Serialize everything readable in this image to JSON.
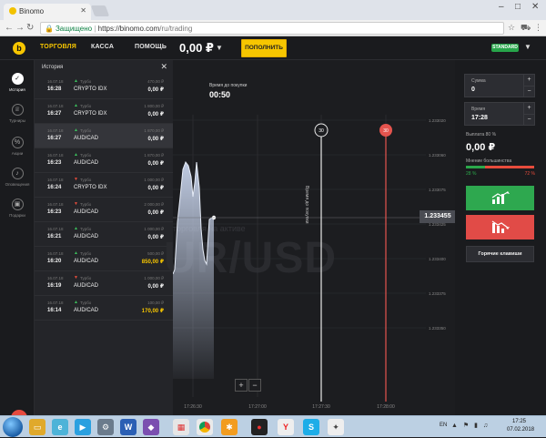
{
  "browser": {
    "tab_title": "Binomo",
    "url_secure": "Защищено",
    "url_domain": "https://binomo.com",
    "url_path": "/ru/trading"
  },
  "topbar": {
    "nav": [
      "ТОРГОВЛЯ",
      "КАССА",
      "ПОМОЩЬ"
    ],
    "balance": "0,00 ₽",
    "deposit_label": "ПОПОЛНИТЬ",
    "status_badge": "STANDARD"
  },
  "rail": {
    "items": [
      "История",
      "Турниры",
      "Акции",
      "Оповещения",
      "Подарки"
    ]
  },
  "history": {
    "title": "История",
    "rows": [
      {
        "date": "16.07.18",
        "time": "16:28",
        "dir": "up",
        "type": "Турбо",
        "asset": "CRYPTO IDX",
        "invest": "470,00 ₽",
        "payout": "0,00 ₽"
      },
      {
        "date": "16.07.18",
        "time": "16:27",
        "dir": "up",
        "type": "Турбо",
        "asset": "CRYPTO IDX",
        "invest": "1 800,00 ₽",
        "payout": "0,00 ₽"
      },
      {
        "date": "16.07.18",
        "time": "16:27",
        "dir": "up",
        "type": "Турбо",
        "asset": "AUD/CAD",
        "invest": "1 870,00 ₽",
        "payout": "0,00 ₽"
      },
      {
        "date": "16.07.18",
        "time": "16:23",
        "dir": "up",
        "type": "Турбо",
        "asset": "AUD/CAD",
        "invest": "1 870,00 ₽",
        "payout": "0,00 ₽"
      },
      {
        "date": "16.07.18",
        "time": "16:24",
        "dir": "dn",
        "type": "Турбо",
        "asset": "CRYPTO IDX",
        "invest": "1 000,00 ₽",
        "payout": "0,00 ₽"
      },
      {
        "date": "16.07.18",
        "time": "16:23",
        "dir": "dn",
        "type": "Турбо",
        "asset": "AUD/CAD",
        "invest": "2 000,00 ₽",
        "payout": "0,00 ₽"
      },
      {
        "date": "16.07.18",
        "time": "16:21",
        "dir": "up",
        "type": "Турбо",
        "asset": "AUD/CAD",
        "invest": "1 000,00 ₽",
        "payout": "0,00 ₽"
      },
      {
        "date": "16.07.18",
        "time": "16:20",
        "dir": "up",
        "type": "Турбо",
        "asset": "AUD/CAD",
        "invest": "500,00 ₽",
        "payout": "850,00 ₽"
      },
      {
        "date": "16.07.18",
        "time": "16:19",
        "dir": "dn",
        "type": "Турбо",
        "asset": "AUD/CAD",
        "invest": "1 000,00 ₽",
        "payout": "0,00 ₽"
      },
      {
        "date": "16.07.18",
        "time": "16:14",
        "dir": "up",
        "type": "Турбо",
        "asset": "AUD/CAD",
        "invest": "100,00 ₽",
        "payout": "170,00 ₽"
      }
    ]
  },
  "chart": {
    "buy_label": "Время до покупки",
    "buy_time": "00:50",
    "vertical_label": "Время до покупки",
    "bg_caption": "торговля на активе",
    "bg_asset": "UR/USD",
    "price_tag": "1.233455",
    "marker_buy": "30",
    "marker_expire": "30",
    "price_ticks": [
      "1.233020",
      "1.233060",
      "1.233075",
      "1.233425",
      "1.233400",
      "1.233375",
      "1.233350"
    ],
    "time_ticks": [
      "17:26:30",
      "17:27:00",
      "17:27:30",
      "17:28:00"
    ],
    "zoom_in": "+",
    "zoom_out": "−",
    "colors": {
      "up": "#2ea84f",
      "down": "#e14b47",
      "accent": "#f7c600"
    }
  },
  "panel": {
    "amount_label": "Сумма",
    "amount_value": "0",
    "time_label": "Время",
    "time_value": "17:28",
    "payout_label": "Выплата 80 %",
    "payout_value": "0,00 ₽",
    "majority_label": "Мнение большинства",
    "majority_up_pct": 28,
    "majority_up": "28 %",
    "majority_down": "72 %",
    "hotkeys_label": "Горячие клавиши"
  },
  "taskbar": {
    "lang": "EN",
    "time": "17:25",
    "date": "07.02.2018"
  }
}
